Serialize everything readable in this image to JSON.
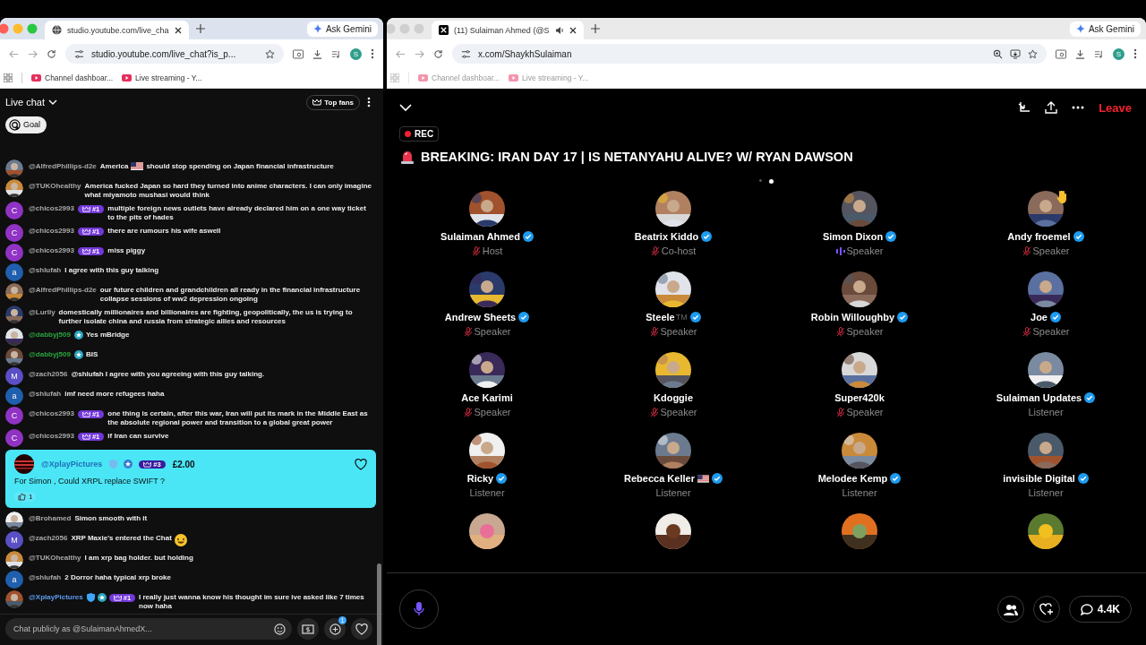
{
  "windows": [
    {
      "active": true,
      "tab_icon": {
        "kind": "globe"
      },
      "tab_title": "studio.youtube.com/live_cha",
      "audio": false,
      "url": "studio.youtube.com/live_chat?is_p...",
      "zoomed": false,
      "ask": "Ask Gemini",
      "profile": "S",
      "bookmarks": [
        "Channel dashboar...",
        "Live streaming - Y..."
      ]
    },
    {
      "active": false,
      "tab_icon": {
        "kind": "x"
      },
      "tab_title": "(11) Sulaiman Ahmed (@S",
      "audio": true,
      "url": "x.com/ShaykhSulaiman",
      "zoomed": true,
      "ask": "Ask Gemini",
      "profile": "S",
      "bookmarks": [
        "Channel dashboar...",
        "Live streaming - Y..."
      ]
    }
  ],
  "chat": {
    "title": "Live chat",
    "top_fans": "Top fans",
    "goal": "Goal",
    "messages": [
      {
        "kind": "chat",
        "avatar": {
          "kind": "picture"
        },
        "author": {
          "name": "@AlfredPhillips-d2e",
          "color": "#aaaaaa"
        },
        "verified": false,
        "member": false,
        "segments": [
          {
            "kind": "text",
            "text": "America"
          },
          {
            "kind": "flag"
          },
          {
            "kind": "text",
            "text": "should stop spending on Japan financial infrastructure"
          }
        ]
      },
      {
        "kind": "chat",
        "avatar": {
          "kind": "picture"
        },
        "author": {
          "name": "@TUKOhealthy",
          "color": "#aaaaaa"
        },
        "verified": false,
        "member": false,
        "text": "America fucked Japan so hard they turned into anime characters. I can only imagine what miyamoto mushasi would think"
      },
      {
        "kind": "chat",
        "avatar": {
          "kind": "letter",
          "initial": "C",
          "color": "#9033c4"
        },
        "author": {
          "name": "@chicos2993",
          "color": "#aaaaaa"
        },
        "verified": false,
        "member": false,
        "rank": "#1",
        "text": "multiple foreign news outlets have already declared him on a one way ticket to the pits of hades"
      },
      {
        "kind": "chat",
        "avatar": {
          "kind": "letter",
          "initial": "C",
          "color": "#9033c4"
        },
        "author": {
          "name": "@chicos2993",
          "color": "#aaaaaa"
        },
        "verified": false,
        "member": false,
        "rank": "#1",
        "text": "there are rumours his wife aswell"
      },
      {
        "kind": "chat",
        "avatar": {
          "kind": "letter",
          "initial": "C",
          "color": "#9033c4"
        },
        "author": {
          "name": "@chicos2993",
          "color": "#aaaaaa"
        },
        "verified": false,
        "member": false,
        "rank": "#1",
        "text": "miss piggy"
      },
      {
        "kind": "chat",
        "avatar": {
          "kind": "letter",
          "initial": "a",
          "color": "#1f5fae"
        },
        "author": {
          "name": "@shlufah",
          "color": "#aaaaaa"
        },
        "verified": false,
        "member": false,
        "text": "I agree with this guy talking"
      },
      {
        "kind": "chat",
        "avatar": {
          "kind": "picture"
        },
        "author": {
          "name": "@AlfredPhillips-d2e",
          "color": "#aaaaaa"
        },
        "verified": false,
        "member": false,
        "text": "our future children and grandchildren all ready in the financial infrastructure collapse sessions of ww2 depression ongoing"
      },
      {
        "kind": "chat",
        "avatar": {
          "kind": "picture"
        },
        "author": {
          "name": "@Lurlly",
          "color": "#aaaaaa"
        },
        "verified": false,
        "member": false,
        "text": "domestically millionaires and billionaires are fighting, geopolitically, the us is trying to further isolate china and russia from strategic allies and resources"
      },
      {
        "kind": "chat",
        "avatar": {
          "kind": "picture"
        },
        "author": {
          "name": "@dabbyj509",
          "color": "#2ba640"
        },
        "verified": false,
        "member": true,
        "text": "Yes mBridge"
      },
      {
        "kind": "chat",
        "avatar": {
          "kind": "picture"
        },
        "author": {
          "name": "@dabbyj509",
          "color": "#2ba640"
        },
        "verified": false,
        "member": true,
        "text": "BIS"
      },
      {
        "kind": "chat",
        "avatar": {
          "kind": "letter",
          "initial": "M",
          "color": "#5a4fc4"
        },
        "author": {
          "name": "@zach2056",
          "color": "#aaaaaa"
        },
        "verified": false,
        "member": false,
        "text": "@shlufah I agree with you agreeing with this guy talking."
      },
      {
        "kind": "chat",
        "avatar": {
          "kind": "letter",
          "initial": "a",
          "color": "#1f5fae"
        },
        "author": {
          "name": "@shlufah",
          "color": "#aaaaaa"
        },
        "verified": false,
        "member": false,
        "text": "imf need more refugees haha"
      },
      {
        "kind": "chat",
        "avatar": {
          "kind": "letter",
          "initial": "C",
          "color": "#9033c4"
        },
        "author": {
          "name": "@chicos2993",
          "color": "#aaaaaa"
        },
        "verified": false,
        "member": false,
        "rank": "#1",
        "text": "one thing is certain, after this war, Iran will put its mark in the Middle East as the absolute regional power and transition to a global great power"
      },
      {
        "kind": "chat",
        "avatar": {
          "kind": "letter",
          "initial": "C",
          "color": "#9033c4"
        },
        "author": {
          "name": "@chicos2993",
          "color": "#aaaaaa"
        },
        "verified": false,
        "member": false,
        "rank": "#1",
        "text": "if Iran can survive"
      },
      {
        "kind": "superchat",
        "avatar": {
          "kind": "picture"
        },
        "author": {
          "name": "@XplayPictures",
          "color": "#1f6fb8"
        },
        "verified": true,
        "member": true,
        "rank": "#3",
        "amount": "£2.00",
        "text": "For Simon , Could XRPL replace SWIFT ?",
        "likes": "1"
      },
      {
        "kind": "chat",
        "avatar": {
          "kind": "picture"
        },
        "author": {
          "name": "@Brohamed",
          "color": "#aaaaaa"
        },
        "verified": false,
        "member": false,
        "text": "Simon smooth with it"
      },
      {
        "kind": "chat",
        "avatar": {
          "kind": "letter",
          "initial": "M",
          "color": "#5a4fc4"
        },
        "author": {
          "name": "@zach2056",
          "color": "#aaaaaa"
        },
        "verified": false,
        "member": false,
        "segments": [
          {
            "kind": "text",
            "text": "XRP Maxie's entered the Chat"
          },
          {
            "kind": "emoji"
          }
        ]
      },
      {
        "kind": "chat",
        "avatar": {
          "kind": "picture"
        },
        "author": {
          "name": "@TUKOhealthy",
          "color": "#aaaaaa"
        },
        "verified": false,
        "member": false,
        "text": "I am xrp bag holder. but holding"
      },
      {
        "kind": "chat",
        "avatar": {
          "kind": "letter",
          "initial": "a",
          "color": "#1f5fae"
        },
        "author": {
          "name": "@shlufah",
          "color": "#aaaaaa"
        },
        "verified": false,
        "member": false,
        "text": "2 Dorror haha typical xrp broke"
      },
      {
        "kind": "chat",
        "avatar": {
          "kind": "picture"
        },
        "author": {
          "name": "@XplayPictures",
          "color": "#5e9cf0"
        },
        "verified": true,
        "member": true,
        "rank": "#1",
        "text": "I really just wanna know his thought im sure ive asked like 7 times now haha"
      }
    ],
    "input": {
      "placeholder": "Chat publicly as @SulaimanAhmedX..."
    },
    "plus_badge": "1"
  },
  "space": {
    "leave": "Leave",
    "rec": "REC",
    "title": "BREAKING: IRAN DAY 17 | IS NETANYAHU ALIVE? W/ RYAN DAWSON",
    "pages": [
      {
        "selected": false
      },
      {
        "selected": true
      }
    ],
    "participants": [
      {
        "name": "Sulaiman Ahmed",
        "verified": true,
        "flag": false,
        "hand_raised": false,
        "mic": {
          "kind": "muted"
        },
        "role": "Host"
      },
      {
        "name": "Beatrix Kiddo",
        "verified": true,
        "flag": false,
        "hand_raised": false,
        "mic": {
          "kind": "muted"
        },
        "role": "Co-host"
      },
      {
        "name": "Simon Dixon",
        "verified": true,
        "flag": false,
        "hand_raised": false,
        "mic": {
          "kind": "speaking"
        },
        "role": "Speaker"
      },
      {
        "name": "Andy froemel",
        "verified": true,
        "flag": false,
        "hand_raised": true,
        "mic": {
          "kind": "muted"
        },
        "role": "Speaker"
      },
      {
        "name": "Andrew Sheets",
        "verified": true,
        "flag": false,
        "hand_raised": false,
        "mic": {
          "kind": "muted"
        },
        "role": "Speaker"
      },
      {
        "name": "Steele",
        "suffix": "TM",
        "verified": true,
        "flag": false,
        "hand_raised": false,
        "mic": {
          "kind": "muted"
        },
        "role": "Speaker"
      },
      {
        "name": "Robin Willoughby",
        "verified": true,
        "flag": false,
        "hand_raised": false,
        "mic": {
          "kind": "muted"
        },
        "role": "Speaker"
      },
      {
        "name": "Joe",
        "verified": true,
        "flag": false,
        "hand_raised": false,
        "mic": {
          "kind": "muted"
        },
        "role": "Speaker"
      },
      {
        "name": "Ace Karimi",
        "verified": false,
        "flag": false,
        "hand_raised": false,
        "mic": {
          "kind": "muted"
        },
        "role": "Speaker"
      },
      {
        "name": "Kdoggie",
        "verified": false,
        "flag": false,
        "hand_raised": false,
        "mic": {
          "kind": "muted"
        },
        "role": "Speaker"
      },
      {
        "name": "Super420k",
        "verified": false,
        "flag": false,
        "hand_raised": false,
        "mic": {
          "kind": "muted"
        },
        "role": "Speaker"
      },
      {
        "name": "Sulaiman Updates",
        "verified": true,
        "flag": false,
        "hand_raised": false,
        "role": "Listener"
      },
      {
        "name": "Ricky",
        "verified": true,
        "flag": false,
        "hand_raised": false,
        "role": "Listener"
      },
      {
        "name": "Rebecca Keller",
        "verified": true,
        "flag": true,
        "hand_raised": false,
        "role": "Listener"
      },
      {
        "name": "Melodee Kemp",
        "verified": true,
        "flag": false,
        "hand_raised": false,
        "role": "Listener"
      },
      {
        "name": "invisible Digital",
        "verified": true,
        "flag": false,
        "hand_raised": false,
        "role": "Listener"
      }
    ],
    "more_avatars": [
      {
        "kind": "picture"
      },
      {
        "kind": "picture"
      },
      {
        "kind": "picture"
      },
      {
        "kind": "picture"
      }
    ],
    "comments": "4.4K"
  }
}
